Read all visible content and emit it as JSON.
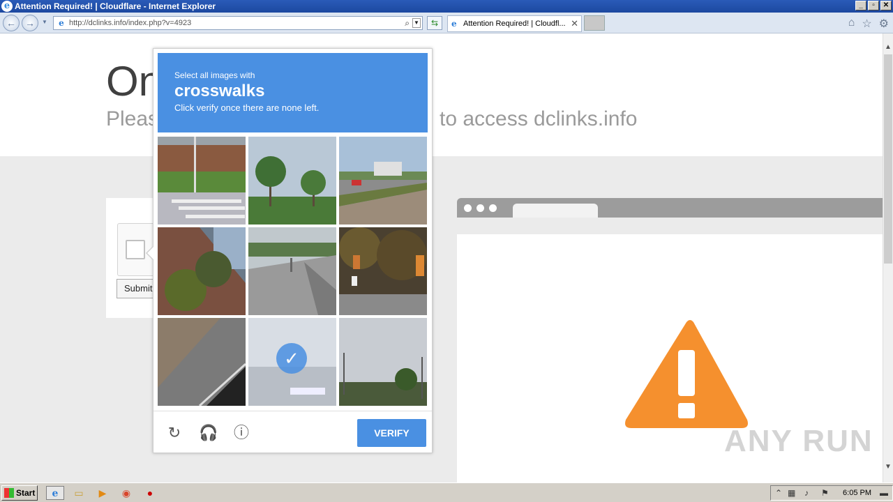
{
  "window": {
    "title": "Attention Required! | Cloudflare - Internet Explorer"
  },
  "addressbar": {
    "url": "http://dclinks.info/index.php?v=4923"
  },
  "tab": {
    "label": "Attention Required! | Cloudfl..."
  },
  "page": {
    "heading": "On",
    "subheading_left": "Pleas",
    "subheading_right": "to access dclinks.info",
    "submit_label": "Submit"
  },
  "captcha": {
    "line1": "Select all images with",
    "line2": "crosswalks",
    "line3": "Click verify once there are none left.",
    "verify_label": "VERIFY",
    "selected_tile": 8,
    "accent_color": "#4a90e2"
  },
  "warning_color": "#f5902e",
  "watermark": "ANY RUN",
  "taskbar": {
    "start_label": "Start",
    "clock": "6:05 PM"
  }
}
